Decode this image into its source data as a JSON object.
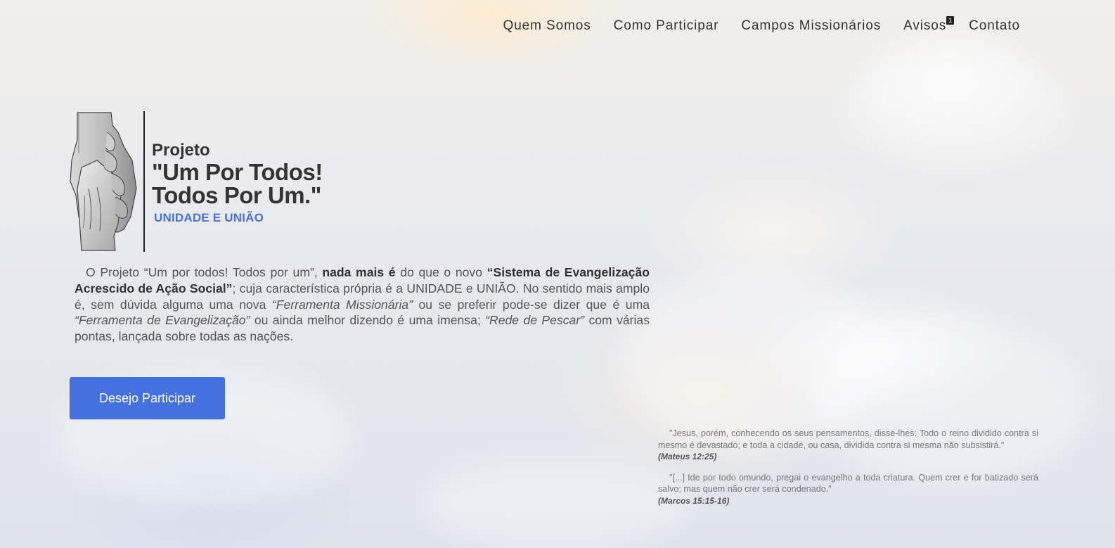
{
  "nav": {
    "items": [
      {
        "label": "Quem Somos"
      },
      {
        "label": "Como Participar"
      },
      {
        "label": "Campos Missionários"
      },
      {
        "label": "Avisos",
        "badge": "1"
      },
      {
        "label": "Contato"
      }
    ]
  },
  "logo": {
    "pre_title": "Projeto",
    "title_line1": "\"Um Por Todos!",
    "title_line2": "Todos Por Um.\"",
    "subtitle": "UNIDADE E UNIÃO"
  },
  "intro": {
    "p1": "O Projeto “Um por todos! Todos por um”, ",
    "b1": "nada mais é",
    "p2": " do que o novo ",
    "b2": "“Sistema de Evangelização Acrescido de Ação Social”",
    "p3": "; cuja característica própria é a UNIDADE e UNIÃO. No sentido mais amplo é, sem dúvida alguma uma nova ",
    "i1": "“Ferramenta Missionária”",
    "p4": " ou se preferir pode-se dizer que é uma ",
    "i2": "“Ferramenta de Evangelização”",
    "p5": " ou ainda melhor dizendo é uma imensa; ",
    "i3": "“Rede de Pescar”",
    "p6": " com várias pontas, lançada sobre todas as nações."
  },
  "cta": {
    "label": "Desejo Participar"
  },
  "quotes": [
    {
      "text": "\"Jesus, porém, conhecendo os seus pensamentos, disse-lhes: Todo o reino dividido contra si mesmo é devastado; e toda a cidade, ou casa, dividida contra si mesma não subsistirá.\"",
      "ref": "(Mateus 12:25)"
    },
    {
      "text": "\"[...] Ide por todo omundo, pregai o evangelho a toda criatura. Quem crer e for batizado será salvo; mas quem não crer será condenado.\"",
      "ref": "(Marcos 15:15-16)"
    }
  ],
  "colors": {
    "accent": "#4571e0",
    "subtitle": "#4a72d6",
    "text": "#333333"
  },
  "icons": {
    "logo": "holding-hands-icon"
  }
}
